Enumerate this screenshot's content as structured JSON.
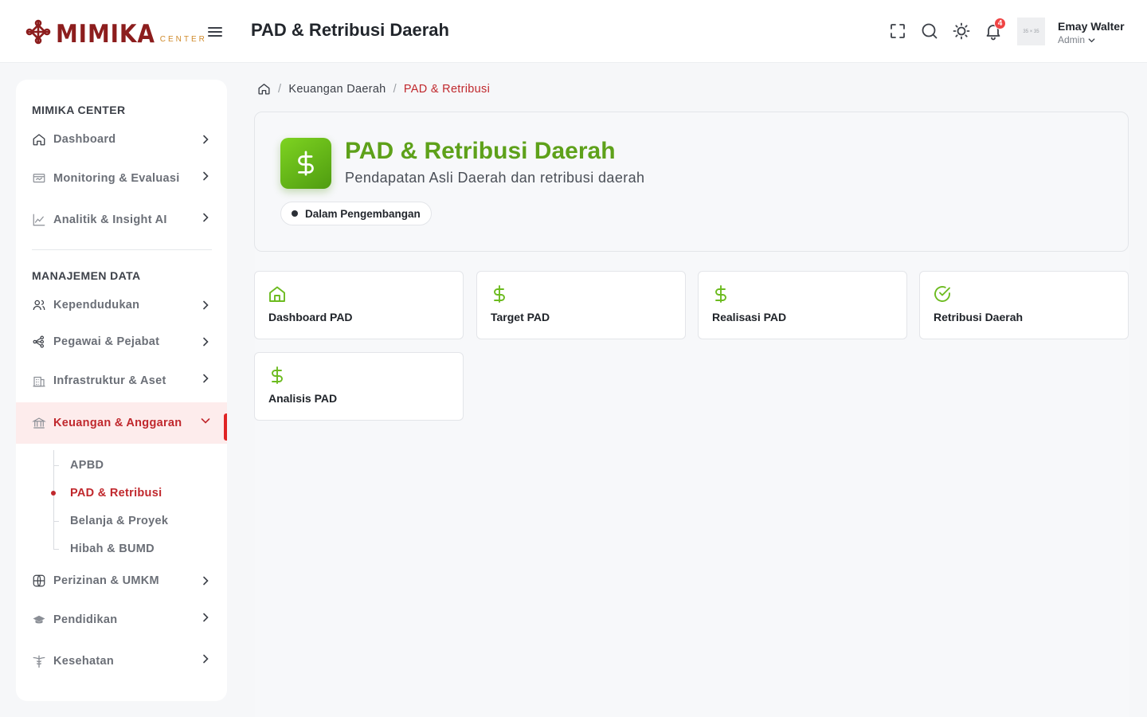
{
  "app": {
    "logo_text": "MIMIKA",
    "logo_sub": "CENTER",
    "page_title": "PAD & Retribusi Daerah"
  },
  "header": {
    "notification_count": "4",
    "avatar_placeholder": "35 × 35",
    "user_name": "Emay Walter",
    "user_role": "Admin"
  },
  "sidebar": {
    "section_1": "MIMIKA CENTER",
    "section_2": "MANAJEMEN DATA",
    "items": [
      {
        "label": "Dashboard",
        "icon": "home-icon"
      },
      {
        "label": "Monitoring & Evaluasi",
        "icon": "monitor-icon"
      },
      {
        "label": "Analitik & Insight AI",
        "icon": "chart-icon"
      },
      {
        "label": "Kependudukan",
        "icon": "users-icon"
      },
      {
        "label": "Pegawai & Pejabat",
        "icon": "org-icon"
      },
      {
        "label": "Infrastruktur & Aset",
        "icon": "building-icon"
      },
      {
        "label": "Keuangan & Anggaran",
        "icon": "bank-icon"
      },
      {
        "label": "Perizinan & UMKM",
        "icon": "globe-icon"
      },
      {
        "label": "Pendidikan",
        "icon": "graduation-cap-icon"
      },
      {
        "label": "Kesehatan",
        "icon": "caduceus-icon"
      }
    ],
    "sub_items": [
      "APBD",
      "PAD & Retribusi",
      "Belanja & Proyek",
      "Hibah & BUMD"
    ]
  },
  "breadcrumb": {
    "parent": "Keuangan Daerah",
    "current": "PAD & Retribusi"
  },
  "hero": {
    "title": "PAD & Retribusi Daerah",
    "subtitle": "Pendapatan Asli Daerah dan retribusi daerah",
    "status": "Dalam Pengembangan"
  },
  "cards": [
    {
      "label": "Dashboard PAD",
      "icon": "home-icon"
    },
    {
      "label": "Target PAD",
      "icon": "dollar-icon"
    },
    {
      "label": "Realisasi PAD",
      "icon": "dollar-icon"
    },
    {
      "label": "Retribusi Daerah",
      "icon": "check-circle-icon"
    },
    {
      "label": "Analisis PAD",
      "icon": "dollar-icon"
    }
  ],
  "colors": {
    "brand": "#8c1d1d",
    "accent_red": "#c0282d",
    "accent_green": "#5ea11a"
  }
}
